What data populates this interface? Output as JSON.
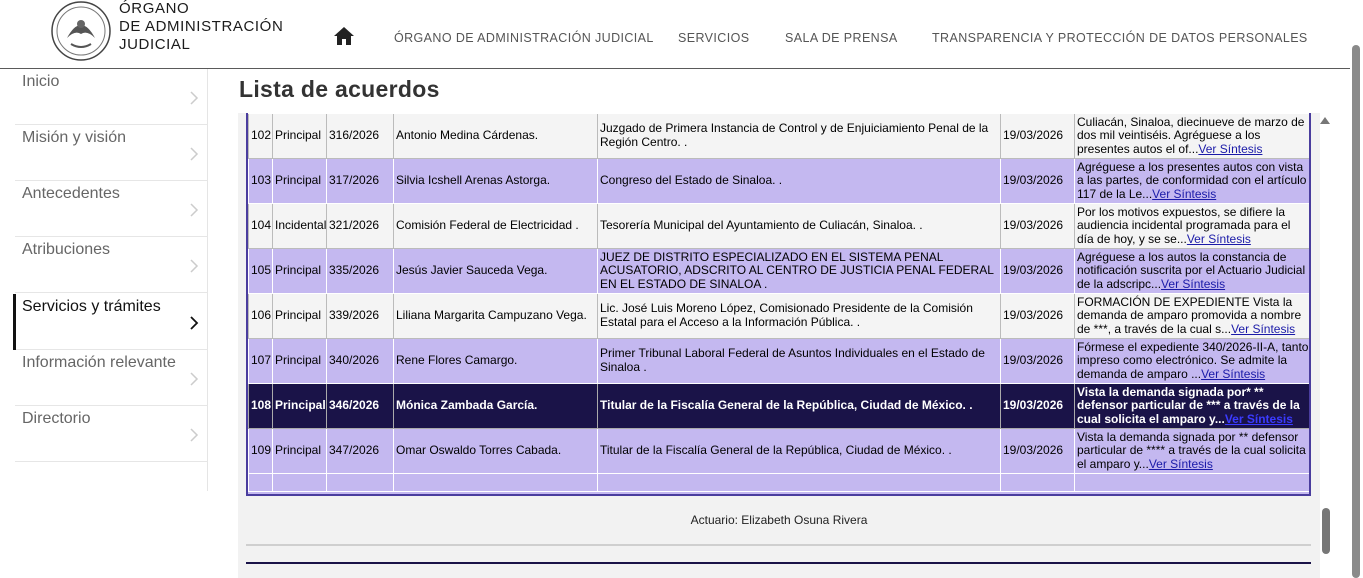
{
  "header": {
    "logo_lines": [
      "ÓRGANO",
      "DE ADMINISTRACIÓN",
      "JUDICIAL"
    ],
    "nav": [
      {
        "label": "ÓRGANO DE ADMINISTRACIÓN JUDICIAL"
      },
      {
        "label": "SERVICIOS"
      },
      {
        "label": "SALA DE PRENSA"
      },
      {
        "label": "TRANSPARENCIA Y PROTECCIÓN DE DATOS PERSONALES"
      }
    ]
  },
  "sidebar": {
    "items": [
      {
        "label": "Inicio"
      },
      {
        "label": "Misión y visión"
      },
      {
        "label": "Antecedentes"
      },
      {
        "label": "Atribuciones"
      },
      {
        "label": "Servicios y trámites"
      },
      {
        "label": "Información relevante"
      },
      {
        "label": "Directorio"
      }
    ],
    "active_index": 4
  },
  "main": {
    "title": "Lista de acuerdos",
    "link_label": "Ver Síntesis",
    "rows": [
      {
        "num": "102",
        "tipo": "Principal",
        "exp": "316/2026",
        "actor": "Antonio Medina Cárdenas.",
        "autoridad": "Juzgado de Primera Instancia de Control y de Enjuiciamiento Penal de la Región Centro. .",
        "fecha": "19/03/2026",
        "sintesis": "Culiacán, Sinaloa, diecinueve de marzo de dos mil veintiséis. Agréguese a los presentes autos el of..."
      },
      {
        "num": "103",
        "tipo": "Principal",
        "exp": "317/2026",
        "actor": "Silvia Icshell Arenas Astorga.",
        "autoridad": "Congreso del Estado de Sinaloa. .",
        "fecha": "19/03/2026",
        "sintesis": "Agréguese a los presentes autos con vista a las partes, de conformidad con el artículo 117 de la Le..."
      },
      {
        "num": "104",
        "tipo": "Incidental",
        "exp": "321/2026",
        "actor": "Comisión Federal de Electricidad .",
        "autoridad": "Tesorería Municipal del Ayuntamiento de Culiacán, Sinaloa. .",
        "fecha": "19/03/2026",
        "sintesis": "Por los motivos expuestos, se difiere la audiencia incidental programada para el día de hoy, y se se..."
      },
      {
        "num": "105",
        "tipo": "Principal",
        "exp": "335/2026",
        "actor": "Jesús Javier Sauceda Vega.",
        "autoridad": "JUEZ DE DISTRITO ESPECIALIZADO EN EL SISTEMA PENAL ACUSATORIO, ADSCRITO AL CENTRO DE JUSTICIA PENAL FEDERAL EN EL ESTADO DE SINALOA .",
        "fecha": "19/03/2026",
        "sintesis": "Agréguese a los autos la constancia de notificación suscrita por el Actuario Judicial de la adscripc..."
      },
      {
        "num": "106",
        "tipo": "Principal",
        "exp": "339/2026",
        "actor": "Liliana Margarita Campuzano Vega.",
        "autoridad": "Lic. José Luis Moreno López, Comisionado Presidente de la Comisión Estatal para el Acceso a la Información Pública. .",
        "fecha": "19/03/2026",
        "sintesis": "FORMACIÓN DE EXPEDIENTE Vista la demanda de amparo promovida a nombre de ***, a través de la cual s..."
      },
      {
        "num": "107",
        "tipo": "Principal",
        "exp": "340/2026",
        "actor": "Rene Flores Camargo.",
        "autoridad": "Primer Tribunal Laboral Federal de Asuntos Individuales en el Estado de Sinaloa .",
        "fecha": "19/03/2026",
        "sintesis": "Fórmese el expediente 340/2026-II-A, tanto impreso como electrónico. Se admite la demanda de amparo ..."
      },
      {
        "num": "108",
        "tipo": "Principal",
        "exp": "346/2026",
        "actor": "Mónica Zambada García.",
        "autoridad": "Titular de la Fiscalía General de la República, Ciudad de México. .",
        "fecha": "19/03/2026",
        "sintesis": "Vista la demanda signada por* ** defensor particular de *** a través de la cual solicita el amparo y..."
      },
      {
        "num": "109",
        "tipo": "Principal",
        "exp": "347/2026",
        "actor": "Omar Oswaldo Torres Cabada.",
        "autoridad": "Titular de la Fiscalía General de la República, Ciudad de México. .",
        "fecha": "19/03/2026",
        "sintesis": "Vista la demanda signada por ** defensor particular de **** a través de la cual solicita el amparo y..."
      }
    ],
    "actuario": "Actuario: Elizabeth Osuna Rivera"
  },
  "colors": {
    "row_purple": "#c4b8f0",
    "row_light": "#f4f4f4",
    "row_selected": "#1a1348",
    "frame": "#4a3d9e",
    "link": "#1a1aa8"
  }
}
